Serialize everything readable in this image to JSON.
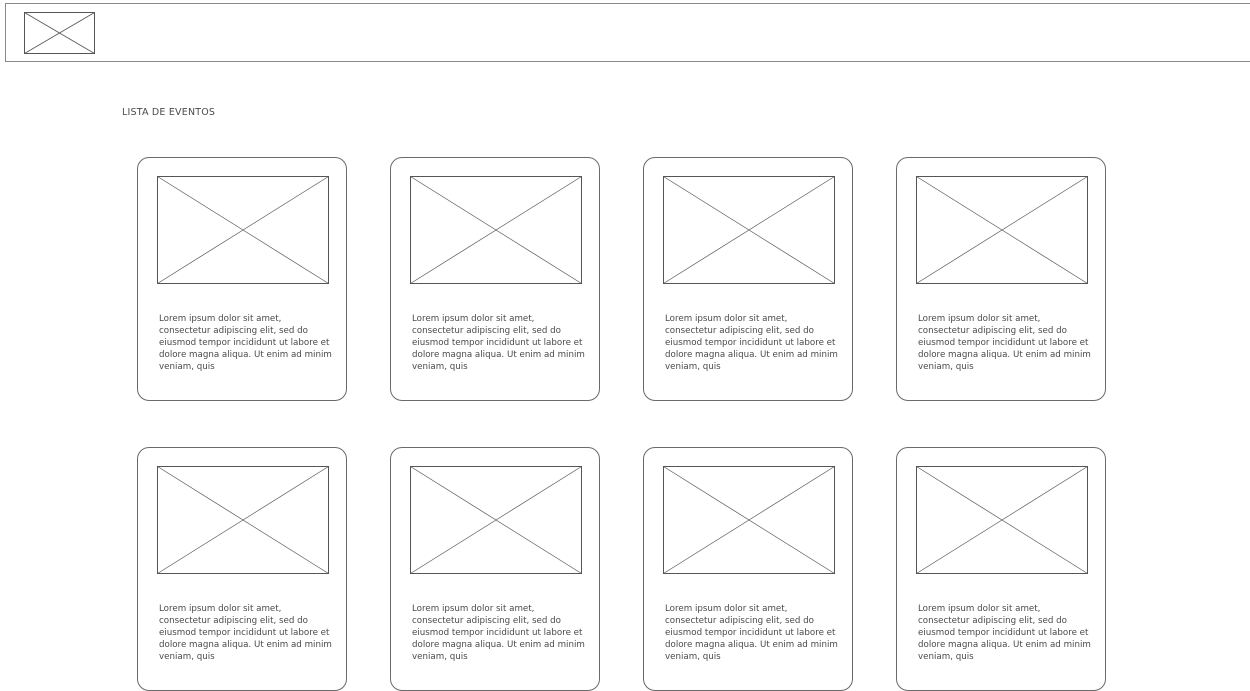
{
  "header": {
    "logo_icon": "image-placeholder-icon"
  },
  "page": {
    "title": "LISTA DE EVENTOS"
  },
  "events": [
    {
      "image_icon": "image-placeholder-icon",
      "description": "Lorem ipsum dolor sit amet, consectetur adipiscing elit, sed do eiusmod tempor incididunt ut labore et dolore magna aliqua. Ut enim ad minim veniam, quis"
    },
    {
      "image_icon": "image-placeholder-icon",
      "description": "Lorem ipsum dolor sit amet, consectetur adipiscing elit, sed do eiusmod tempor incididunt ut labore et dolore magna aliqua. Ut enim ad minim veniam, quis"
    },
    {
      "image_icon": "image-placeholder-icon",
      "description": "Lorem ipsum dolor sit amet, consectetur adipiscing elit, sed do eiusmod tempor incididunt ut labore et dolore magna aliqua. Ut enim ad minim veniam, quis"
    },
    {
      "image_icon": "image-placeholder-icon",
      "description": "Lorem ipsum dolor sit amet, consectetur adipiscing elit, sed do eiusmod tempor incididunt ut labore et dolore magna aliqua. Ut enim ad minim veniam, quis"
    },
    {
      "image_icon": "image-placeholder-icon",
      "description": "Lorem ipsum dolor sit amet, consectetur adipiscing elit, sed do eiusmod tempor incididunt ut labore et dolore magna aliqua. Ut enim ad minim veniam, quis"
    },
    {
      "image_icon": "image-placeholder-icon",
      "description": "Lorem ipsum dolor sit amet, consectetur adipiscing elit, sed do eiusmod tempor incididunt ut labore et dolore magna aliqua. Ut enim ad minim veniam, quis"
    },
    {
      "image_icon": "image-placeholder-icon",
      "description": "Lorem ipsum dolor sit amet, consectetur adipiscing elit, sed do eiusmod tempor incididunt ut labore et dolore magna aliqua. Ut enim ad minim veniam, quis"
    },
    {
      "image_icon": "image-placeholder-icon",
      "description": "Lorem ipsum dolor sit amet, consectetur adipiscing elit, sed do eiusmod tempor incididunt ut labore et dolore magna aliqua. Ut enim ad minim veniam, quis"
    }
  ],
  "colors": {
    "border": "#6a6a6a",
    "text": "#4a4a4a",
    "background": "#ffffff"
  }
}
